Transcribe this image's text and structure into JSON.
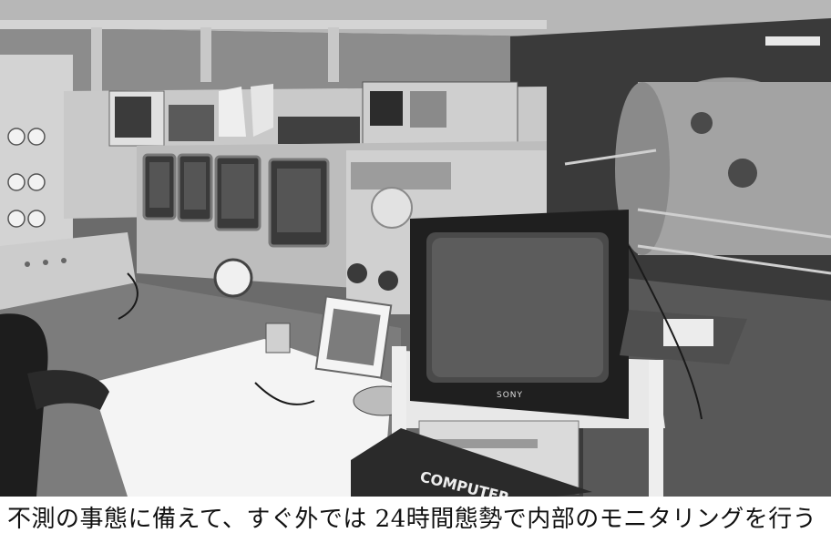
{
  "photo": {
    "description_icon": "control-room-photo",
    "monitor_brand": "SONY",
    "keyboard_brand": "COMPUTER"
  },
  "caption": {
    "text": "不測の事態に備えて、すぐ外では 24時間態勢で内部のモニタリングを行う"
  },
  "colors": {
    "caption_bg": "#ffffff",
    "caption_text": "#111111"
  }
}
